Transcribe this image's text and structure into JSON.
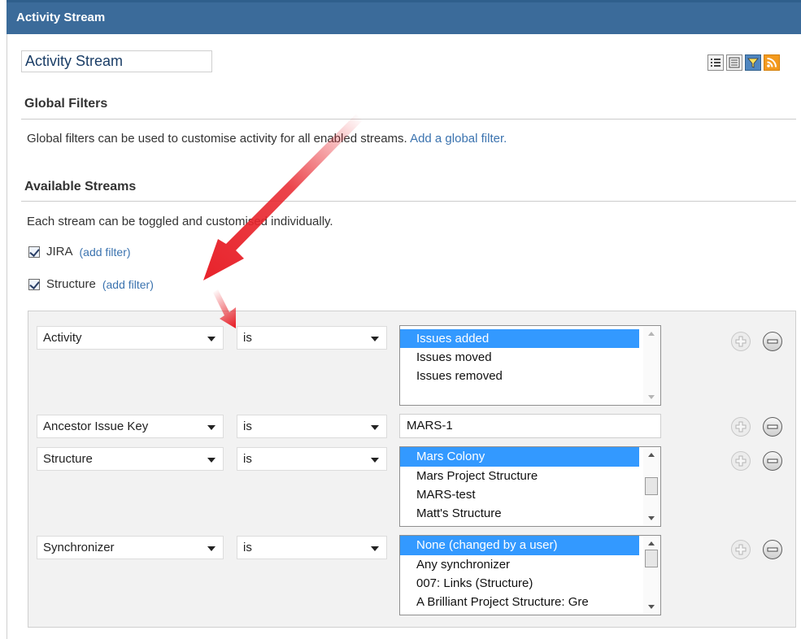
{
  "header": {
    "title": "Activity Stream"
  },
  "title_field": {
    "value": "Activity Stream"
  },
  "toolbar": {
    "buttons": [
      {
        "name": "list-view",
        "icon": "list-view-icon"
      },
      {
        "name": "detail-view",
        "icon": "detail-view-icon"
      },
      {
        "name": "filter",
        "icon": "filter-icon"
      },
      {
        "name": "rss-feed",
        "icon": "rss-icon"
      }
    ]
  },
  "global_filters": {
    "heading": "Global Filters",
    "text": "Global filters can be used to customise activity for all enabled streams.",
    "link": "Add a global filter."
  },
  "available_streams": {
    "heading": "Available Streams",
    "text": "Each stream can be toggled and customised individually.",
    "streams": [
      {
        "label": "JIRA",
        "checked": true,
        "add_filter": "(add filter)"
      },
      {
        "label": "Structure",
        "checked": true,
        "add_filter": "(add filter)"
      }
    ]
  },
  "filters": [
    {
      "field": "Activity",
      "operator": "is",
      "values": [
        "Issues added",
        "Issues moved",
        "Issues removed"
      ],
      "selected": 0
    },
    {
      "field": "Ancestor Issue Key",
      "operator": "is",
      "text_value": "MARS-1"
    },
    {
      "field": "Structure",
      "operator": "is",
      "values": [
        "Mars Colony",
        "Mars Project Structure",
        "MARS-test",
        "Matt's Structure"
      ],
      "selected": 0
    },
    {
      "field": "Synchronizer",
      "operator": "is",
      "values": [
        "None (changed by a user)",
        "Any synchronizer",
        "007: Links (Structure)",
        "A Brilliant Project Structure: Gre"
      ],
      "selected": 0
    }
  ],
  "colors": {
    "header_bg": "#3b6b9a",
    "link": "#3b73af",
    "selection": "#3399ff",
    "annotation_arrow": "#e8242c"
  }
}
